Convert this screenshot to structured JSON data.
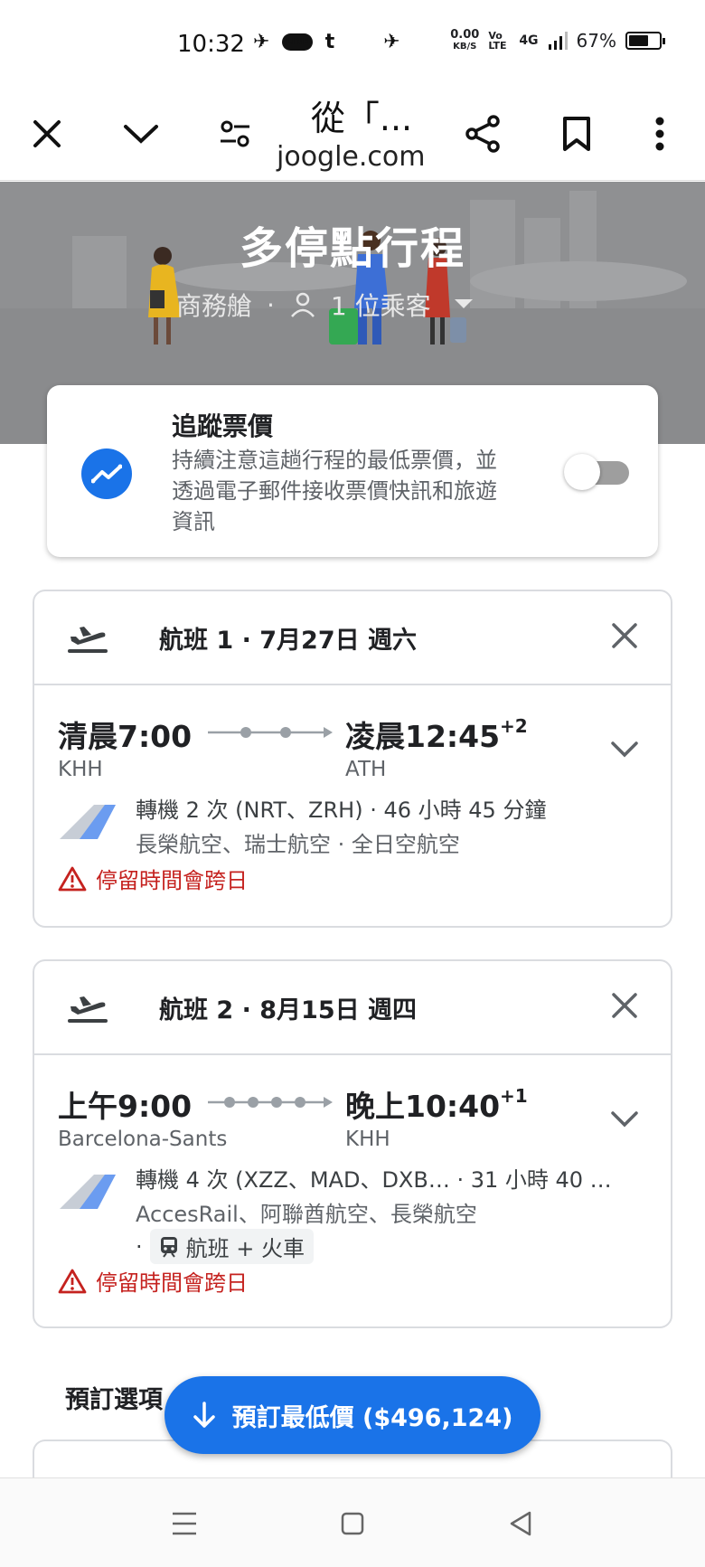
{
  "status_bar": {
    "time": "10:32",
    "net_speed_value": "0.00",
    "net_speed_unit": "KB/S",
    "volte": "Vo LTE",
    "network": "4G",
    "battery": "67%",
    "battery_level": 0.67
  },
  "browser": {
    "title": "從「...",
    "url": "joogle.com"
  },
  "hero": {
    "title": "多停點行程",
    "cabin": "商務艙",
    "separator": "·",
    "passengers": "1 位乘客"
  },
  "track": {
    "title": "追蹤票價",
    "description": "持續注意這趟行程的最低票價，並透過電子郵件接收票價快訊和旅遊資訊",
    "enabled": false
  },
  "flights": [
    {
      "header": "航班 1 · 7月27日 週六",
      "depart_time": "清晨7:00",
      "arrive_time": "凌晨12:45",
      "arrive_offset": "+2",
      "depart_airport": "KHH",
      "arrive_airport": "ATH",
      "stops_text": "轉機 2 次 (NRT、ZRH) · 46 小時 45 分鐘",
      "carriers": "長榮航空、瑞士航空 · 全日空航空",
      "warning": "停留時間會跨日",
      "stop_count": 2
    },
    {
      "header": "航班 2 · 8月15日 週四",
      "depart_time": "上午9:00",
      "arrive_time": "晚上10:40",
      "arrive_offset": "+1",
      "depart_airport": "Barcelona-Sants",
      "arrive_airport": "KHH",
      "stops_text": "轉機 4 次 (XZZ、MAD、DXB…  · 31 小時 40 …",
      "carriers": "AccesRail、阿聯酋航空、長榮航空",
      "train_dot": "·",
      "train_tag": "航班 + 火車",
      "warning": "停留時間會跨日",
      "stop_count": 4
    }
  ],
  "booking": {
    "label": "預訂選項",
    "button": "預訂最低價 ($496,124)"
  },
  "icons": {
    "close": "close-icon",
    "collapse": "chevron-down-icon",
    "filters": "tune-icon",
    "share": "share-icon",
    "bookmark": "bookmark-icon",
    "more": "more-vert-icon",
    "accent": "#1a73e8",
    "warning_color": "#c5221f"
  }
}
